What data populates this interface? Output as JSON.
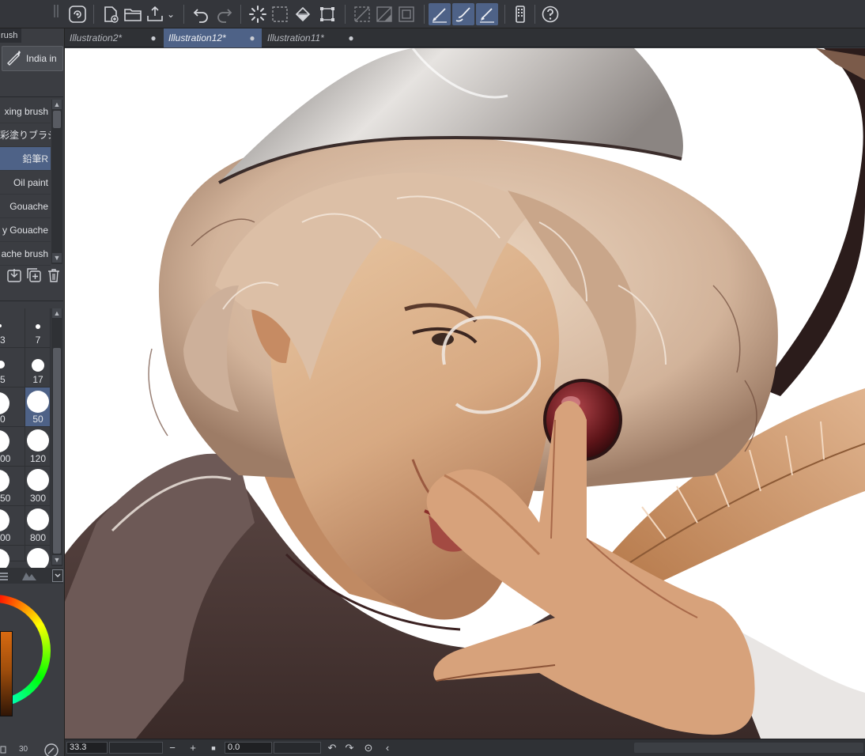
{
  "toolbar": {
    "icons": [
      "clip-studio-logo-icon",
      "new-canvas-icon",
      "open-folder-icon",
      "export-icon",
      "undo-icon",
      "redo-icon",
      "loading-spinner-icon",
      "selection-icon",
      "fill-bucket-icon",
      "transform-icon",
      "hide-selection-icon",
      "ruler-icon",
      "border-icon",
      "pen-tool-icon",
      "brush-tool-icon",
      "eraser-tool-icon",
      "smartphone-icon",
      "help-icon"
    ]
  },
  "left_panel": {
    "panel_tab_label": "rush",
    "subtool_button_label": "India in",
    "brushes": [
      {
        "label": "xing brush"
      },
      {
        "label": "彩塗りブラシ"
      },
      {
        "label": "鉛筆R",
        "selected": true
      },
      {
        "label": "Oil paint"
      },
      {
        "label": "Gouache"
      },
      {
        "label": "y Gouache"
      },
      {
        "label": "ache brush"
      }
    ],
    "brush_sizes": [
      {
        "label": "3"
      },
      {
        "label": "7"
      },
      {
        "label": "5"
      },
      {
        "label": "17"
      },
      {
        "label": "0"
      },
      {
        "label": "50",
        "selected": true
      },
      {
        "label": "00"
      },
      {
        "label": "120"
      },
      {
        "label": "50"
      },
      {
        "label": "300"
      },
      {
        "label": "00"
      },
      {
        "label": "800"
      }
    ],
    "bottom_text": "30",
    "colors": {
      "main": "#d86a10",
      "selection": "#4e6287"
    }
  },
  "document_tabs": [
    {
      "label": "Illustration2*",
      "active": false
    },
    {
      "label": "Illustration12*",
      "active": true
    },
    {
      "label": "Illustration11*",
      "active": false
    }
  ],
  "status_bar": {
    "zoom": "33.3",
    "zoom_out": "−",
    "zoom_in": "+",
    "fit": "■",
    "rotation": "0.0"
  }
}
